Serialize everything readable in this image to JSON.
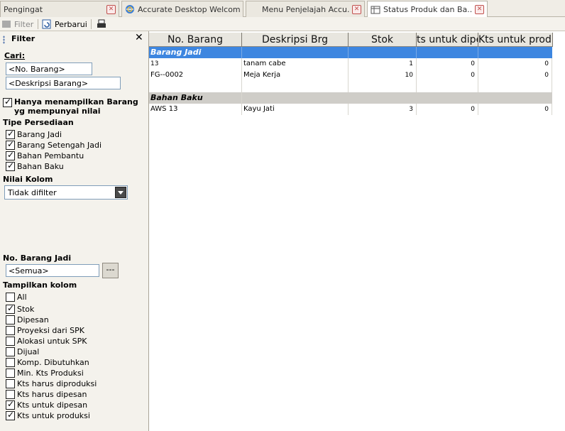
{
  "tabs": [
    {
      "label": "Pengingat",
      "icon": "none"
    },
    {
      "label": "Accurate Desktop Welcome...",
      "icon": "browser-icon"
    },
    {
      "label": "Menu Penjelajah Accu...",
      "icon": "none"
    },
    {
      "label": "Status Produk dan Ba...",
      "icon": "table-icon"
    }
  ],
  "toolbar": {
    "filter_label": "Filter",
    "refresh_label": "Perbarui"
  },
  "filter_panel": {
    "title": "Filter",
    "search_label": "Cari:",
    "search_no_placeholder": "<No. Barang>",
    "search_desc_placeholder": "<Deskripsi Barang>",
    "only_value_line1": "Hanya menampilkan Barang",
    "only_value_line2": "yg mempunyai nilai",
    "stock_type_label": "Tipe Persediaan",
    "stock_types": [
      {
        "label": "Barang Jadi",
        "checked": true
      },
      {
        "label": "Barang Setengah Jadi",
        "checked": true
      },
      {
        "label": "Bahan Pembantu",
        "checked": true
      },
      {
        "label": "Bahan Baku",
        "checked": true
      }
    ],
    "column_value_label": "Nilai Kolom",
    "column_value_selected": "Tidak difilter",
    "finished_item_label": "No. Barang Jadi",
    "finished_item_value": "<Semua>",
    "browse_button": "---",
    "show_columns_label": "Tampilkan kolom",
    "columns": [
      {
        "label": "All",
        "checked": false
      },
      {
        "label": "Stok",
        "checked": true
      },
      {
        "label": "Dipesan",
        "checked": false
      },
      {
        "label": "Proyeksi dari SPK",
        "checked": false
      },
      {
        "label": "Alokasi untuk SPK",
        "checked": false
      },
      {
        "label": "Dijual",
        "checked": false
      },
      {
        "label": "Komp. Dibutuhkan",
        "checked": false
      },
      {
        "label": "Min. Kts Produksi",
        "checked": false
      },
      {
        "label": "Kts harus diproduksi",
        "checked": false
      },
      {
        "label": "Kts harus dipesan",
        "checked": false
      },
      {
        "label": "Kts untuk dipesan",
        "checked": true
      },
      {
        "label": "Kts untuk produksi",
        "checked": true
      }
    ]
  },
  "grid": {
    "headers": [
      "No. Barang",
      "Deskripsi Brg",
      "Stok",
      "ts untuk dipes",
      "Kts untuk produksi"
    ],
    "groups": [
      {
        "name": "Barang Jadi",
        "rows": [
          [
            "13",
            "tanam cabe",
            "1",
            "0",
            "0"
          ],
          [
            "FG--0002",
            "Meja Kerja",
            "10",
            "0",
            "0"
          ]
        ]
      },
      {
        "name": "Bahan Baku",
        "rows": [
          [
            "AWS 13",
            "Kayu Jati",
            "3",
            "0",
            "0"
          ]
        ]
      }
    ]
  },
  "colors": {
    "group_selected": "#3d86e0",
    "group_normal": "#cfcdc8",
    "accent": "#c0504d"
  }
}
